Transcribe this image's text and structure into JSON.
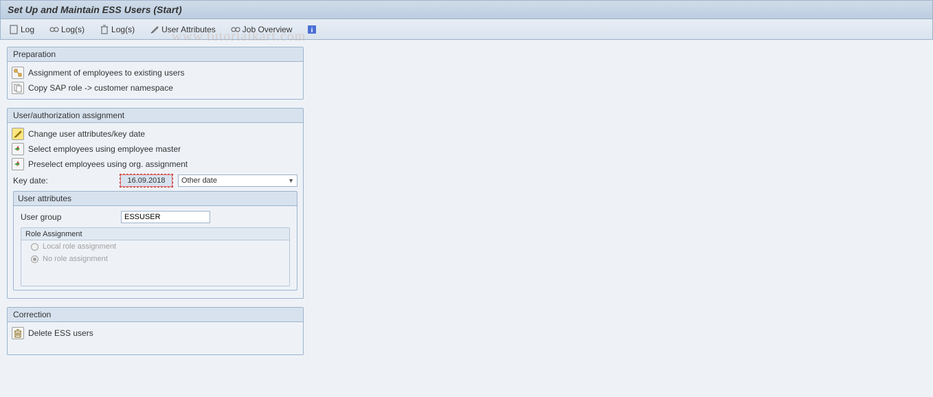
{
  "title": "Set Up and Maintain ESS Users (Start)",
  "toolbar": {
    "log": "Log",
    "logs": "Log(s)",
    "logs_delete": "Log(s)",
    "user_attributes": "User Attributes",
    "job_overview": "Job Overview"
  },
  "panels": {
    "preparation": {
      "title": "Preparation",
      "item1": "Assignment of employees to existing users",
      "item2": "Copy SAP role -> customer namespace"
    },
    "assignment": {
      "title": "User/authorization assignment",
      "item1": "Change user attributes/key date",
      "item2": "Select employees using employee master",
      "item3": "Preselect employees using org. assignment",
      "key_date_label": "Key date:",
      "key_date_value": "16.09.2018",
      "other_date": "Other date"
    },
    "user_attributes": {
      "title": "User attributes",
      "user_group_label": "User group",
      "user_group_value": "ESSUSER",
      "role_assignment_title": "Role Assignment",
      "local_role": "Local role assignment",
      "no_role": "No role assignment"
    },
    "correction": {
      "title": "Correction",
      "item1": "Delete ESS users"
    }
  },
  "watermark": "www.tutorialkart.com"
}
